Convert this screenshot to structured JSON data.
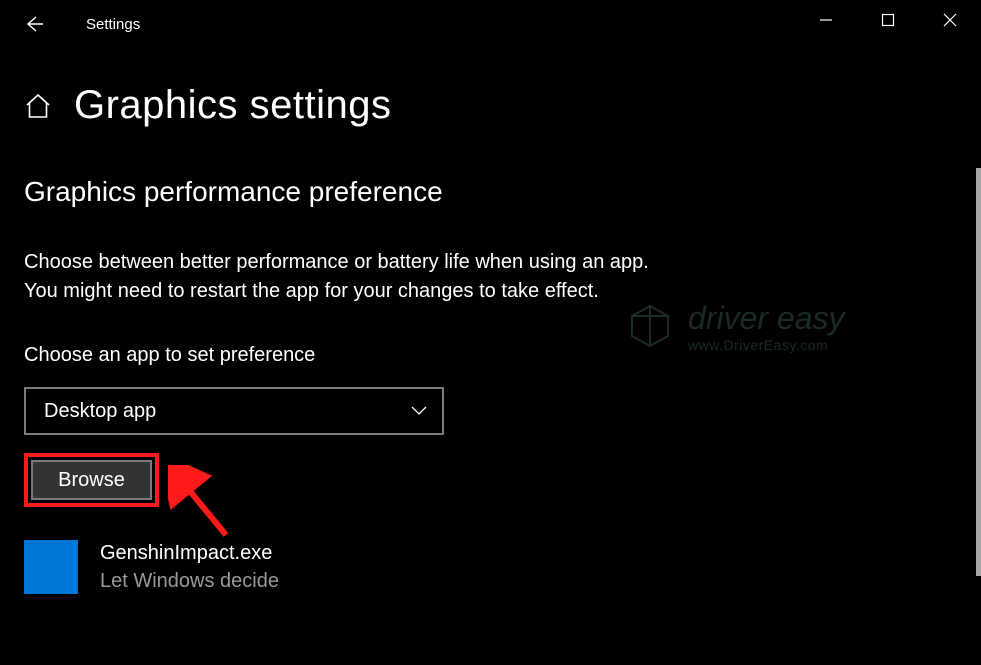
{
  "titlebar": {
    "title": "Settings"
  },
  "page": {
    "title": "Graphics settings",
    "subheading": "Graphics performance preference",
    "description_line1": "Choose between better performance or battery life when using an app.",
    "description_line2": "You might need to restart the app for your changes to take effect.",
    "choose_label": "Choose an app to set preference"
  },
  "dropdown": {
    "selected": "Desktop app"
  },
  "buttons": {
    "browse": "Browse"
  },
  "app_list": [
    {
      "name": "GenshinImpact.exe",
      "status": "Let Windows decide"
    }
  ],
  "watermark": {
    "brand": "driver easy",
    "url": "www.DriverEasy.com"
  }
}
